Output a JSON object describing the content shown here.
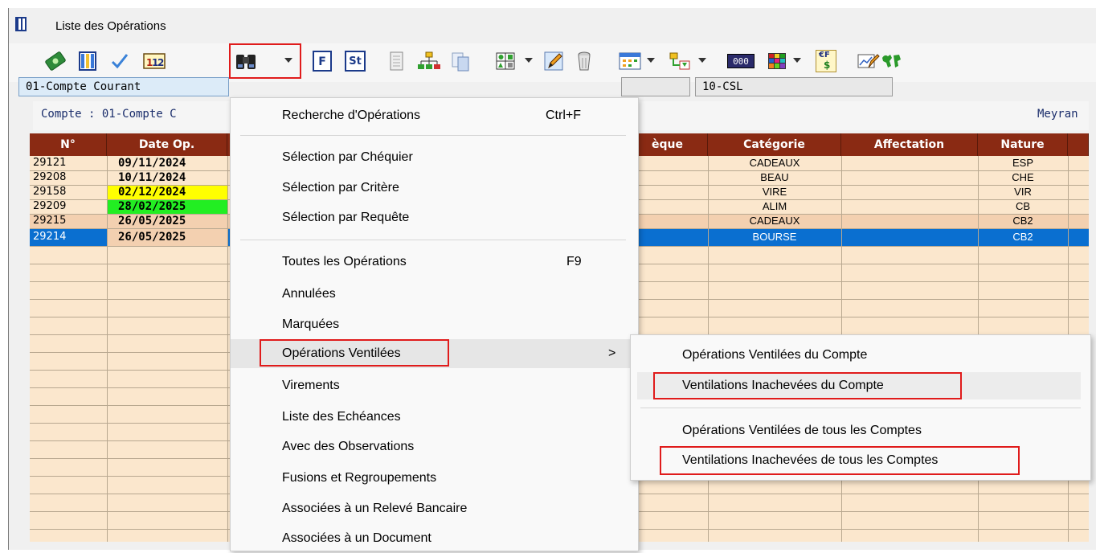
{
  "window": {
    "title": "Liste des Opérations"
  },
  "fields": {
    "account": "01-Compte Courant",
    "right": "10-CSL",
    "middle": ""
  },
  "compte_line": {
    "left": "Compte : 01-Compte C",
    "right": "Meyran"
  },
  "table": {
    "headers": [
      "N°",
      "Date Op.",
      "èque",
      "Catégorie",
      "Affectation",
      "Nature"
    ],
    "rows": [
      {
        "num": "29121",
        "date": "09/11/2024",
        "categorie": "CADEAUX",
        "nature": "ESP"
      },
      {
        "num": "29208",
        "date": "10/11/2024",
        "categorie": "BEAU",
        "nature": "CHE"
      },
      {
        "num": "29158",
        "date": "02/12/2024",
        "categorie": "VIRE",
        "nature": "VIR"
      },
      {
        "num": "29209",
        "date": "28/02/2025",
        "categorie": "ALIM",
        "nature": "CB"
      },
      {
        "num": "29215",
        "date": "26/05/2025",
        "categorie": "CADEAUX",
        "nature": "CB2"
      },
      {
        "num": "29214",
        "date": "26/05/2025",
        "categorie": "BOURSE",
        "nature": "CB2"
      }
    ],
    "colors": {
      "header": "#8a2a13",
      "row": "#fbe7cd",
      "row_alt": "#f3d6b8",
      "selected": "#0a6fd0",
      "yellow": "#ffff00",
      "green": "#22ee22",
      "orange": "#f3d0b0"
    }
  },
  "menu": {
    "items": [
      {
        "label": "Recherche d'Opérations",
        "shortcut": "Ctrl+F"
      },
      {
        "label": "Sélection par Chéquier"
      },
      {
        "label": "Sélection par Critère"
      },
      {
        "label": "Sélection par Requête"
      },
      {
        "label": "Toutes les Opérations",
        "shortcut": "F9"
      },
      {
        "label": "Annulées"
      },
      {
        "label": "Marquées"
      },
      {
        "label": "Opérations Ventilées",
        "submenu_arrow": ">"
      },
      {
        "label": "Virements"
      },
      {
        "label": "Liste des Echéances"
      },
      {
        "label": "Avec des Observations"
      },
      {
        "label": "Fusions et Regroupements"
      },
      {
        "label": "Associées à un Relevé Bancaire"
      },
      {
        "label": "Associées à un Document"
      }
    ]
  },
  "submenu": {
    "items": [
      {
        "label": "Opérations Ventilées du Compte"
      },
      {
        "label": "Ventilations Inachevées du Compte"
      },
      {
        "label": "Opérations Ventilées de tous les Comptes"
      },
      {
        "label": "Ventilations Inachevées de tous les Comptes"
      }
    ]
  },
  "toolbar": {
    "icons": [
      "money-icon",
      "columns-icon",
      "check-icon",
      "numbers-icon",
      "binoculars-icon",
      "f-icon",
      "st-icon",
      "document-icon",
      "hierarchy-icon",
      "copy-icon",
      "grid-shapes-icon",
      "edit-pen-icon",
      "trash-icon",
      "calendar-icon",
      "filter-icon",
      "counter-icon",
      "color-grid-icon",
      "currency-icon",
      "chart-edit-icon",
      "world-icon"
    ],
    "labels": {
      "f": "F",
      "st": "St",
      "counter": "000",
      "currency_top": "€F",
      "currency_bottom": "$"
    }
  },
  "highlight_color": "#e01b1b"
}
